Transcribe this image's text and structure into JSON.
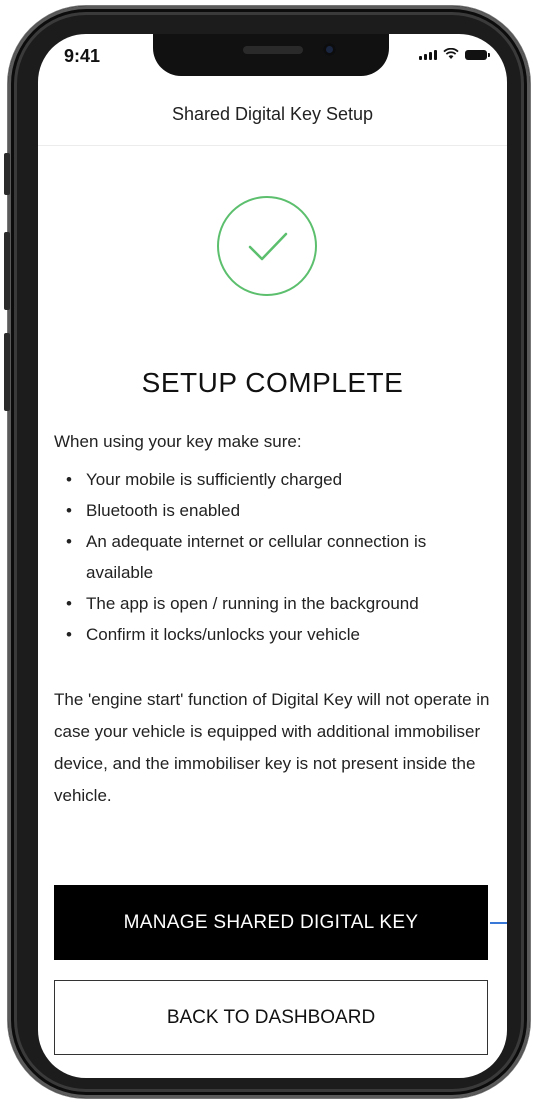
{
  "status_bar": {
    "time": "9:41"
  },
  "header": {
    "title": "Shared Digital Key Setup"
  },
  "success": {
    "icon": "checkmark-icon",
    "color": "#5cbf6e"
  },
  "main": {
    "title": "SETUP COMPLETE",
    "intro": "When using your key make sure:",
    "tips": [
      "Your mobile is sufficiently charged",
      "Bluetooth is enabled",
      "An adequate internet or cellular connection is available",
      "The app is open / running in the background",
      "Confirm it locks/unlocks your vehicle"
    ],
    "bullet": "•",
    "disclaimer": "The 'engine start' function of Digital Key will not operate in case your vehicle is equipped with additional immobiliser device, and the immobiliser key is not present inside the vehicle."
  },
  "actions": {
    "manage_label": "MANAGE SHARED DIGITAL KEY",
    "dashboard_label": "BACK TO DASHBOARD"
  },
  "colors": {
    "primary_button": "#000000",
    "accent": "#5cbf6e",
    "scroll_indicator": "#3a78d8"
  }
}
